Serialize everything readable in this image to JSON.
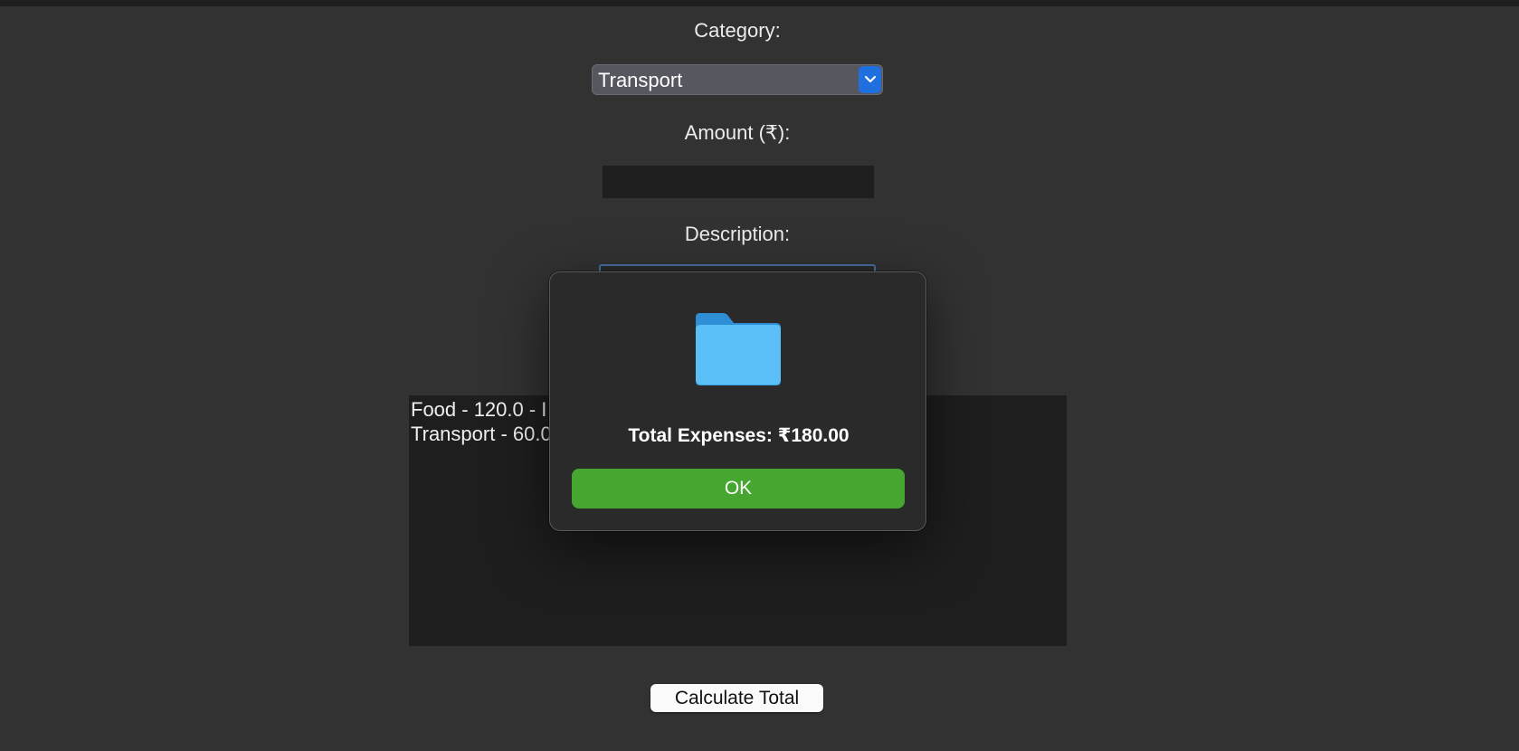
{
  "form": {
    "category_label": "Category:",
    "category_value": "Transport",
    "amount_label": "Amount (₹):",
    "amount_value": "",
    "description_label": "Description:",
    "description_value": ""
  },
  "expense_list": {
    "items": [
      "Food - 120.0 - I",
      "Transport - 60.0"
    ]
  },
  "calculate_button": "Calculate Total",
  "dialog": {
    "icon": "folder-icon",
    "message": "Total Expenses: ₹180.00",
    "ok_label": "OK"
  },
  "colors": {
    "background": "#323232",
    "ok_button": "#45a72f",
    "select_chevron": "#1f6fde",
    "folder": "#5bc0f8"
  }
}
